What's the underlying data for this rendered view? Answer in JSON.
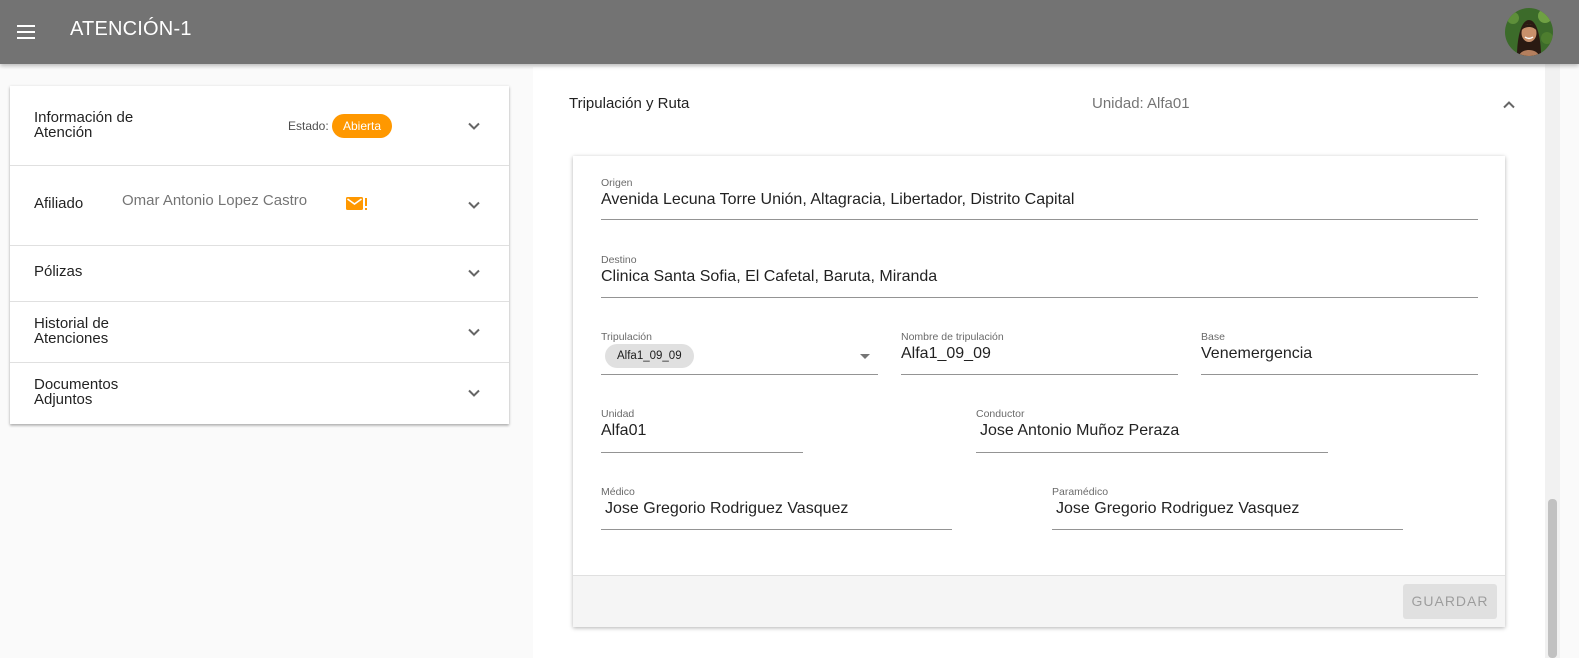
{
  "app": {
    "title": "ATENCIÓN-1"
  },
  "left_panel": {
    "informacion": {
      "title_line1": "Información de",
      "title_line2": "Atención",
      "estado_label": "Estado:",
      "estado_value": "Abierta"
    },
    "afiliado": {
      "title": "Afiliado",
      "name": "Omar Antonio Lopez Castro"
    },
    "polizas": {
      "title": "Pólizas"
    },
    "historial": {
      "title_line1": "Historial de",
      "title_line2": "Atenciones"
    },
    "documentos": {
      "title_line1": "Documentos",
      "title_line2": "Adjuntos"
    }
  },
  "route_section": {
    "title": "Tripulación y Ruta",
    "unidad_header": "Unidad: Alfa01",
    "fields": {
      "origen": {
        "label": "Origen",
        "value": "Avenida Lecuna Torre Unión, Altagracia, Libertador, Distrito Capital"
      },
      "destino": {
        "label": "Destino",
        "value": "Clinica Santa Sofia, El Cafetal, Baruta, Miranda"
      },
      "tripulacion": {
        "label": "Tripulación",
        "value": "Alfa1_09_09"
      },
      "nombre_tripulacion": {
        "label": "Nombre de tripulación",
        "value": "Alfa1_09_09"
      },
      "base": {
        "label": "Base",
        "value": "Venemergencia"
      },
      "unidad": {
        "label": "Unidad",
        "value": "Alfa01"
      },
      "conductor": {
        "label": "Conductor",
        "value": "Jose Antonio Muñoz Peraza"
      },
      "medico": {
        "label": "Médico",
        "value": "Jose Gregorio Rodriguez Vasquez"
      },
      "paramedico": {
        "label": "Paramédico",
        "value": "Jose Gregorio Rodriguez Vasquez"
      }
    },
    "save_label": "GUARDAR"
  },
  "colors": {
    "appbar": "#737373",
    "estado_badge": "#ff9800",
    "mail_icon": "#ff9800"
  },
  "icons": [
    "menu-icon",
    "avatar",
    "chevron-down-icon",
    "mail-alert-icon",
    "chevron-up-icon",
    "dropdown-caret-icon"
  ]
}
